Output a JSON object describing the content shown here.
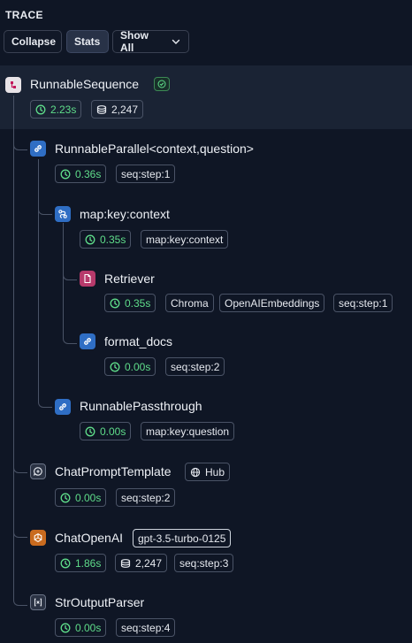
{
  "header": {
    "title": "TRACE"
  },
  "toolbar": {
    "collapse": "Collapse",
    "stats": "Stats",
    "show_all": "Show All"
  },
  "nodes": [
    {
      "title": "RunnableSequence",
      "icon": "sequence-icon",
      "time": "2.23s",
      "tokens": "2,247"
    },
    {
      "title": "RunnableParallel<context,question>",
      "icon": "link-icon",
      "time": "0.36s",
      "tags": [
        "seq:step:1"
      ]
    },
    {
      "title": "map:key:context",
      "icon": "map-icon",
      "time": "0.35s",
      "tags": [
        "map:key:context"
      ]
    },
    {
      "title": "Retriever",
      "icon": "document-icon",
      "time": "0.35s",
      "tags": [
        "Chroma",
        "OpenAIEmbeddings",
        "seq:step:1"
      ]
    },
    {
      "title": "format_docs",
      "icon": "link-icon",
      "time": "0.00s",
      "tags": [
        "seq:step:2"
      ]
    },
    {
      "title": "RunnablePassthrough",
      "icon": "link-icon",
      "time": "0.00s",
      "tags": [
        "map:key:question"
      ]
    },
    {
      "title": "ChatPromptTemplate",
      "icon": "prompt-icon",
      "badge": "Hub",
      "time": "0.00s",
      "tags": [
        "seq:step:2"
      ]
    },
    {
      "title": "ChatOpenAI",
      "icon": "openai-icon",
      "badge": "gpt-3.5-turbo-0125",
      "time": "1.86s",
      "tokens": "2,247",
      "tags": [
        "seq:step:3"
      ]
    },
    {
      "title": "StrOutputParser",
      "icon": "parser-icon",
      "time": "0.00s",
      "tags": [
        "seq:step:4"
      ]
    }
  ],
  "colors": {
    "background": "#0f1625",
    "selected_row": "#1a2334",
    "success": "#5fdd8a",
    "link_icon_bg": "#2f6ec4",
    "retriever_icon_bg": "#b73a6b",
    "openai_icon_bg": "#c96b1f"
  }
}
